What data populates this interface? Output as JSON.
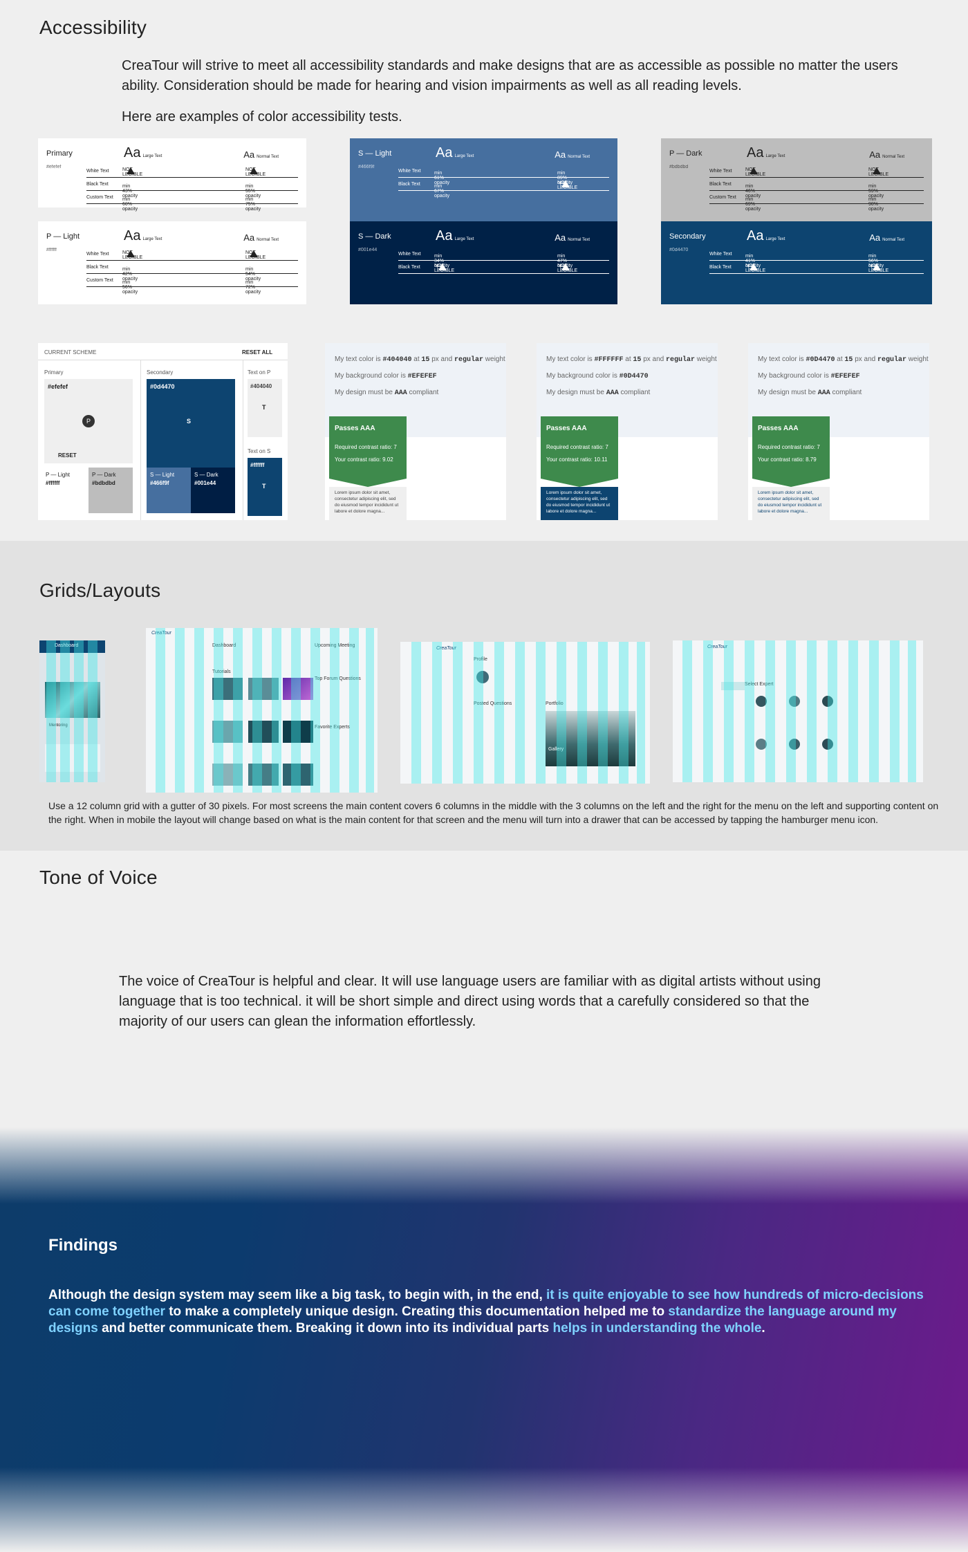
{
  "accessibility": {
    "title": "Accessibility",
    "intro": "CreaTour will strive to meet all accessibility standards and make designs that are as accessible as possible no matter the users ability. Consideration should be made for hearing and vision impairments as well as all reading levels.",
    "examples_label": "Here are examples of color accessibility tests."
  },
  "contrast_cards": [
    {
      "name": "Primary",
      "hex": "#efefef",
      "bg": "#ffffff",
      "fg": "#222222",
      "large": "Aa",
      "large_label": "Large Text",
      "normal": "Aa",
      "normal_label": "Normal Text",
      "rows": [
        [
          "White Text",
          "NOT LEGIBLE",
          "NOT LEGIBLE"
        ],
        [
          "Black Text",
          "min 43% opacity",
          "min 55% opacity"
        ],
        [
          "Custom Text",
          "min 60% opacity",
          "min 75% opacity"
        ]
      ]
    },
    {
      "name": "P — Light",
      "hex": "#ffffff",
      "bg": "#ffffff",
      "fg": "#222222",
      "large": "Aa",
      "large_label": "Large Text",
      "normal": "Aa",
      "normal_label": "Normal Text",
      "rows": [
        [
          "White Text",
          "NOT LEGIBLE",
          "NOT LEGIBLE"
        ],
        [
          "Black Text",
          "min 42% opacity",
          "min 54% opacity"
        ],
        [
          "Custom Text",
          "min 56% opacity",
          "min 72% opacity"
        ]
      ]
    },
    {
      "name": "S — Light",
      "hex": "#466f9f",
      "bg": "#466f9f",
      "fg": "#ffffff",
      "large": "Aa",
      "large_label": "Large Text",
      "normal": "Aa",
      "normal_label": "Normal Text",
      "rows": [
        [
          "White Text",
          "min 61% opacity",
          "min 89% opacity"
        ],
        [
          "Black Text",
          "min 67% opacity",
          "NOT LEGIBLE"
        ]
      ]
    },
    {
      "name": "S — Dark",
      "hex": "#001e44",
      "bg": "#002147",
      "fg": "#ffffff",
      "large": "Aa",
      "large_label": "Large Text",
      "normal": "Aa",
      "normal_label": "Normal Text",
      "rows": [
        [
          "White Text",
          "min 34% opacity",
          "min 47% opacity"
        ],
        [
          "Black Text",
          "NOT LEGIBLE",
          "NOT LEGIBLE"
        ]
      ]
    },
    {
      "name": "P — Dark",
      "hex": "#bdbdbd",
      "bg": "#bdbdbd",
      "fg": "#222222",
      "large": "Aa",
      "large_label": "Large Text",
      "normal": "Aa",
      "normal_label": "Normal Text",
      "rows": [
        [
          "White Text",
          "NOT LEGIBLE",
          "NOT LEGIBLE"
        ],
        [
          "Black Text",
          "min 46% opacity",
          "min 59% opacity"
        ],
        [
          "Custom Text",
          "min 69% opacity",
          "min 90% opacity"
        ]
      ]
    },
    {
      "name": "Secondary",
      "hex": "#0d4470",
      "bg": "#0d4470",
      "fg": "#ffffff",
      "large": "Aa",
      "large_label": "Large Text",
      "normal": "Aa",
      "normal_label": "Normal Text",
      "rows": [
        [
          "White Text",
          "min 41% opacity",
          "min 56% opacity"
        ],
        [
          "Black Text",
          "NOT LEGIBLE",
          "NOT LEGIBLE"
        ]
      ]
    }
  ],
  "scheme": {
    "header": "CURRENT SCHEME",
    "reset_all": "RESET ALL",
    "primary_label": "Primary",
    "primary_hex": "#efefef",
    "p_badge": "P",
    "reset": "RESET",
    "p_light_label": "P — Light",
    "p_light_hex": "#ffffff",
    "p_dark_label": "P — Dark",
    "p_dark_hex": "#bdbdbd",
    "secondary_label": "Secondary",
    "secondary_hex": "#0d4470",
    "s_badge": "S",
    "s_light_label": "S — Light",
    "s_light_hex": "#466f9f",
    "s_dark_label": "S — Dark",
    "s_dark_hex": "#001e44",
    "text_on_p_label": "Text on P",
    "text_on_p_hex": "#404040",
    "t_badge": "T",
    "text_on_s_label": "Text on S",
    "text_on_s_hex": "#ffffff",
    "colors": {
      "primary": "#efefef",
      "secondary": "#0d4470",
      "s_light": "#466f9f",
      "s_dark": "#001e44",
      "p_dark": "#bdbdbd"
    }
  },
  "checkers": [
    {
      "text_color": "#404040",
      "size": "15",
      "weight": "regular",
      "bg_color": "#EFEFEF",
      "level": "AAA",
      "pass": "Passes AAA",
      "required": "Required contrast ratio: 7",
      "yours": "Your contrast ratio: 9.02",
      "lorem_bg": "#efefef",
      "lorem_fg": "#404040",
      "page_bg": "#ffffff"
    },
    {
      "text_color": "#FFFFFF",
      "size": "15",
      "weight": "regular",
      "bg_color": "#0D4470",
      "level": "AAA",
      "pass": "Passes AAA",
      "required": "Required contrast ratio: 7",
      "yours": "Your contrast ratio: 10.11",
      "lorem_bg": "#0d4470",
      "lorem_fg": "#ffffff",
      "page_bg": "#ffffff"
    },
    {
      "text_color": "#0D4470",
      "size": "15",
      "weight": "regular",
      "bg_color": "#EFEFEF",
      "level": "AAA",
      "pass": "Passes AAA",
      "required": "Required contrast ratio: 7",
      "yours": "Your contrast ratio: 8.79",
      "lorem_bg": "#efefef",
      "lorem_fg": "#0d4470",
      "page_bg": "#ffffff"
    }
  ],
  "checker_text": {
    "my_text": "My text color is",
    "at": "at",
    "px_and": "px and",
    "weight": "weight",
    "my_bg": "My background color is",
    "must_be": "My design must be",
    "compliant": "compliant",
    "lorem": "Lorem ipsum dolor sit amet, consectetur adipiscing elit, sed do eiusmod tempor incididunt ut labore et dolore magna..."
  },
  "grids": {
    "title": "Grids/Layouts",
    "caption": "Use a 12 column grid with a gutter of 30 pixels. For most screens the main content covers 6 columns in the middle with the 3 columns on the left and the right for the menu on the left and supporting content on the right. When in mobile the layout will change based on what is the main content for that screen and the menu will turn into a drawer that can be accessed by tapping the hamburger menu icon.",
    "shot_labels": {
      "mobile_title": "Dashboard",
      "mobile_item": "Mentoring",
      "dashboard": "Dashboard",
      "upcoming": "Upcoming Meeting",
      "tutorials": "Tutorials",
      "forum": "Top Forum Questions",
      "experts": "Favorite Experts",
      "brand": "CreaTour",
      "profile": "Profile",
      "posted": "Posted Questions",
      "portfolio": "Portfolio",
      "gallery": "Gallery",
      "select_expert": "Select Expert"
    }
  },
  "tone": {
    "title": "Tone of Voice",
    "text": "The voice of CreaTour is helpful and clear. It will use language users are familiar with as digital artists without using language that is too technical.  it will be short simple and direct using words that a carefully considered so that the majority of our users can glean the information effortlessly."
  },
  "findings": {
    "title": "Findings",
    "p1": "Although the design system may seem like a big task, to begin with, in the end, ",
    "h1": "it is quite enjoyable to see how hundreds of micro-decisions can come together",
    "p2": " to make a completely unique design. Creating this documentation helped me to ",
    "h2": "standardize the language around my designs",
    "p3": " and better communicate them. Breaking it down into its individual parts ",
    "h3": "helps in understanding the whole",
    "p4": "."
  }
}
